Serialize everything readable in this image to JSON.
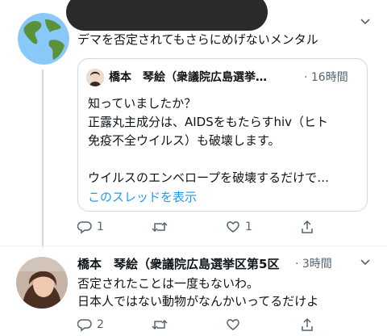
{
  "tweet1": {
    "text": "デマを否定されてもさらにめげないメンタル",
    "avatar_icon": "globe-icon",
    "more_icon": "chevron-down-icon"
  },
  "quote": {
    "author": "橋本　琴絵（衆議院広島選挙…",
    "time": "· 16時間",
    "lines": [
      "知っていましたか？",
      "正露丸主成分は、AIDSをもたらすhiv（ヒト",
      "免疫不全ウイルス）も破壊します。",
      "",
      "ウイルスのエンベロープを破壊するだけで…"
    ],
    "thread_link": "このスレッドを表示"
  },
  "actions1": {
    "reply_count": "1",
    "retweet_count": "",
    "like_count": "1"
  },
  "tweet2": {
    "author": "橋本　琴絵（衆議院広島選挙区第5区",
    "time": "· 3時間",
    "lines": [
      "否定されたことは一度もないわ。",
      "日本人ではない動物がなんかいってるだけよ"
    ]
  },
  "actions2": {
    "reply_count": "2",
    "retweet_count": "",
    "like_count": ""
  },
  "colors": {
    "accent": "#1d9bf0",
    "muted": "#536471",
    "line": "#cfd9de"
  }
}
